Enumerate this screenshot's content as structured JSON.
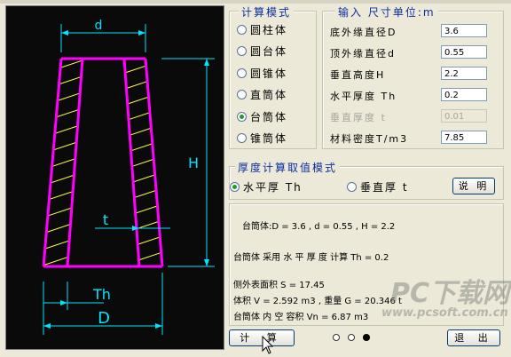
{
  "mode_group": {
    "title": "计算模式",
    "options": [
      "圆柱体",
      "圆台体",
      "圆锥体",
      "直筒体",
      "台筒体",
      "锥筒体"
    ],
    "selected_index": 4
  },
  "input_group": {
    "title": "输入  尺寸单位:m",
    "fields": [
      {
        "label": "底外缘直径D",
        "value": "3.6",
        "enabled": true
      },
      {
        "label": "顶外缘直径d",
        "value": "0.55",
        "enabled": true
      },
      {
        "label": "垂直高度H",
        "value": "2.2",
        "enabled": true
      },
      {
        "label": "水平厚度 Th",
        "value": "0.2",
        "enabled": true
      },
      {
        "label": "垂直厚度 t",
        "value": "0.01",
        "enabled": false
      },
      {
        "label": "材料密度T/m3",
        "value": "7.85",
        "enabled": true
      }
    ]
  },
  "thickness_group": {
    "title": "厚度计算取值模式",
    "option_horizontal": "水平厚 Th",
    "option_vertical": "垂直厚 t",
    "selected": "horizontal",
    "explain_button": "说 明"
  },
  "results": {
    "line1": "台筒体:D = 3.6 , d = 0.55 , H = 2.2",
    "line2": "台筒体 采用 水 平 厚 度 计算 Th = 0.2",
    "line3": "侧外表面积 S = 17.45",
    "line4": "体积 V = 2.592 m3 , 重量 G = 20.346 t",
    "line5": "台筒体 内 空 容积 Vn = 6.87 m3"
  },
  "buttons": {
    "calculate": "计 算",
    "exit": "退 出"
  },
  "diagram_labels": {
    "top_width": "d",
    "height": "H",
    "thickness_t": "t",
    "thickness_th": "Th",
    "bottom_width": "D"
  },
  "watermark": {
    "text": "PC下载网",
    "url": "www.pcsoft.com.cn"
  },
  "colors": {
    "outline": "#ff00ff",
    "dimension": "#00e5ff",
    "hatch": "#ffff40",
    "background": "#0a0a0a"
  }
}
